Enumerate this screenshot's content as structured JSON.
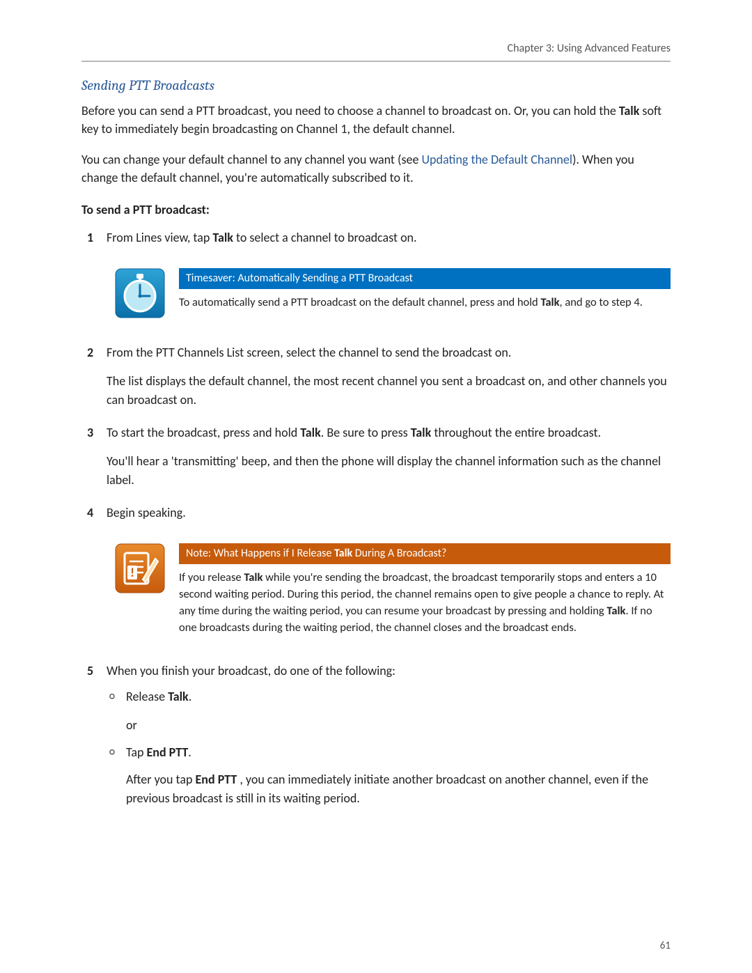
{
  "header": {
    "chapter_line": "Chapter 3: Using Advanced Features"
  },
  "heading": "Sending PTT Broadcasts",
  "intro_p1_a": "Before you can send a PTT broadcast, you need to choose a channel to broadcast on. Or, you can hold the ",
  "intro_p1_b": "Talk",
  "intro_p1_c": " soft key to immediately begin broadcasting on Channel 1, the default channel.",
  "intro_p2_a": "You can change your default channel to any channel you want (see ",
  "intro_p2_link": "Updating the Default Channel",
  "intro_p2_b": "). When you change the default channel, you're automatically subscribed to it.",
  "proc_intro": "To send a PTT broadcast:",
  "steps": {
    "s1_a": "From Lines view, tap ",
    "s1_b": "Talk",
    "s1_c": " to select a channel to broadcast on.",
    "s2_a": "From the PTT Channels List screen, select the channel to send the broadcast on.",
    "s2_p2": "The list displays the default channel, the most recent channel you sent a broadcast on, and other channels you can broadcast on.",
    "s3_a": "To start the broadcast, press and hold ",
    "s3_b": "Talk",
    "s3_c": ". Be sure to press ",
    "s3_d": "Talk",
    "s3_e": " throughout the entire broadcast.",
    "s3_p2": "You'll hear a 'transmitting' beep, and then the phone will display the channel information such as the channel label.",
    "s4": "Begin speaking.",
    "s5_a": "When you finish your broadcast, do one of the following:",
    "s5_opt1_a": "Release ",
    "s5_opt1_b": "Talk",
    "s5_opt1_c": ".",
    "s5_or": "or",
    "s5_opt2_a": "Tap ",
    "s5_opt2_b": "End PTT",
    "s5_opt2_c": ".",
    "s5_after_a": "After you tap ",
    "s5_after_b": "End PTT",
    "s5_after_c": " , you can immediately initiate another broadcast on another channel, even if the previous broadcast is still in its waiting period."
  },
  "callout_timesaver": {
    "title": "Timesaver: Automatically Sending a PTT Broadcast",
    "body_a": "To automatically send a PTT broadcast on the default channel, press and hold ",
    "body_b": "Talk",
    "body_c": ", and go to step 4."
  },
  "callout_note": {
    "title_a": "Note: What Happens if I Release ",
    "title_b": "Talk",
    "title_c": " During A Broadcast?",
    "body_a": "If you release ",
    "body_b": "Talk",
    "body_c": " while you're sending the broadcast, the broadcast temporarily stops and enters a 10 second waiting period. During this period, the channel remains open to give people a chance to reply. At any time during the waiting period, you can resume your broadcast by pressing and holding ",
    "body_d": "Talk",
    "body_e": ". If no one broadcasts during the waiting period, the channel closes and the broadcast ends."
  },
  "page_number": "61"
}
